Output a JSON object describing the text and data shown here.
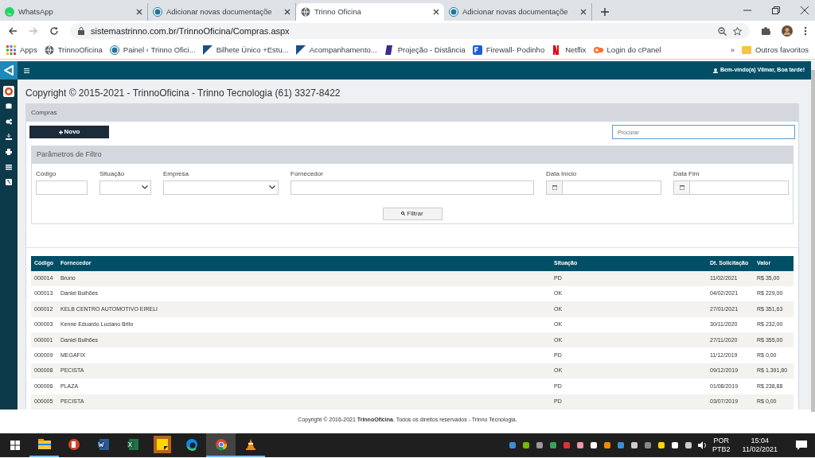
{
  "browser": {
    "tabs": [
      {
        "title": "WhatsApp",
        "selected": false
      },
      {
        "title": "Adicionar novas documentaçõe",
        "selected": false
      },
      {
        "title": "Trinno Oficina",
        "selected": true
      },
      {
        "title": "Adicionar novas documentaçõe",
        "selected": false
      }
    ],
    "address": "sistemastrinno.com.br/TrinnoOficina/Compras.aspx",
    "bookmarks": [
      "Apps",
      "TrinnoOficina",
      "Painel ‹ Trinno Ofici...",
      "Bilhete Único +Estu...",
      "Acompanhamento...",
      "Projeção - Distância",
      "Firewall- Podinho",
      "Netflix",
      "Login do cPanel"
    ],
    "more_bookmarks": "»",
    "other_bookmarks": "Outros favoritos"
  },
  "app": {
    "greeting": "Bem-vindo(a) Vilmar, Boa tarde!",
    "page_title": "Copyright © 2015-2021 - TrinnoOficina - Trinno Tecnologia (61) 3327-8422",
    "panel_title": "Compras",
    "new_button": "Novo",
    "search": {
      "placeholder": "Procurar"
    },
    "filter": {
      "title": "Parâmetros de Filtro",
      "fields": [
        {
          "label": "Código",
          "kind": "text"
        },
        {
          "label": "Situação",
          "kind": "select"
        },
        {
          "label": "Empresa",
          "kind": "select"
        },
        {
          "label": "Fornecedor",
          "kind": "text"
        },
        {
          "label": "Data Início",
          "kind": "date"
        },
        {
          "label": "Data Fim",
          "kind": "date"
        }
      ],
      "button": "Filtrar"
    },
    "table": {
      "columns": [
        "Código",
        "Fornecedor",
        "Situação",
        "Dt. Solicitação",
        "Valor"
      ],
      "rows": [
        [
          "000014",
          "Bruno",
          "PD",
          "11/02/2021",
          "R$ 35,00"
        ],
        [
          "000013",
          "Daniel Bulhões",
          "OK",
          "04/02/2021",
          "R$ 229,00"
        ],
        [
          "000012",
          "KELB CENTRO AUTOMOTIVO EIRELI",
          "OK",
          "27/01/2021",
          "R$ 351,63"
        ],
        [
          "000003",
          "Kenne Eduardo Luciano Brito",
          "OK",
          "30/11/2020",
          "R$ 232,00"
        ],
        [
          "000001",
          "Daniel Bulhões",
          "OK",
          "27/11/2020",
          "R$ 355,00"
        ],
        [
          "000009",
          "MEGAFIX",
          "PD",
          "11/12/2019",
          "R$ 0,00"
        ],
        [
          "000008",
          "PECISTA",
          "OK",
          "09/12/2019",
          "R$ 1.391,80"
        ],
        [
          "000006",
          "PLAZA",
          "PD",
          "01/08/2019",
          "R$ 238,88"
        ],
        [
          "000005",
          "PECISTA",
          "PD",
          "03/07/2019",
          "R$ 0,00"
        ]
      ]
    },
    "footer": "Copyright © 2016-2021 **TrinnoOficina**. Todos os direitos reservados - Trinno Tecnologia."
  },
  "taskbar": {
    "apps": [
      {
        "running": true,
        "selected": false
      },
      {
        "running": false,
        "selected": false
      },
      {
        "running": false,
        "selected": false
      },
      {
        "running": false,
        "selected": false
      },
      {
        "running": false,
        "selected": false
      },
      {
        "running": false,
        "selected": false
      },
      {
        "running": true,
        "selected": true
      },
      {
        "running": true,
        "selected": false
      }
    ],
    "language": "POR",
    "layout": "PTB2",
    "time": "15:04",
    "date": "11/02/2021"
  }
}
